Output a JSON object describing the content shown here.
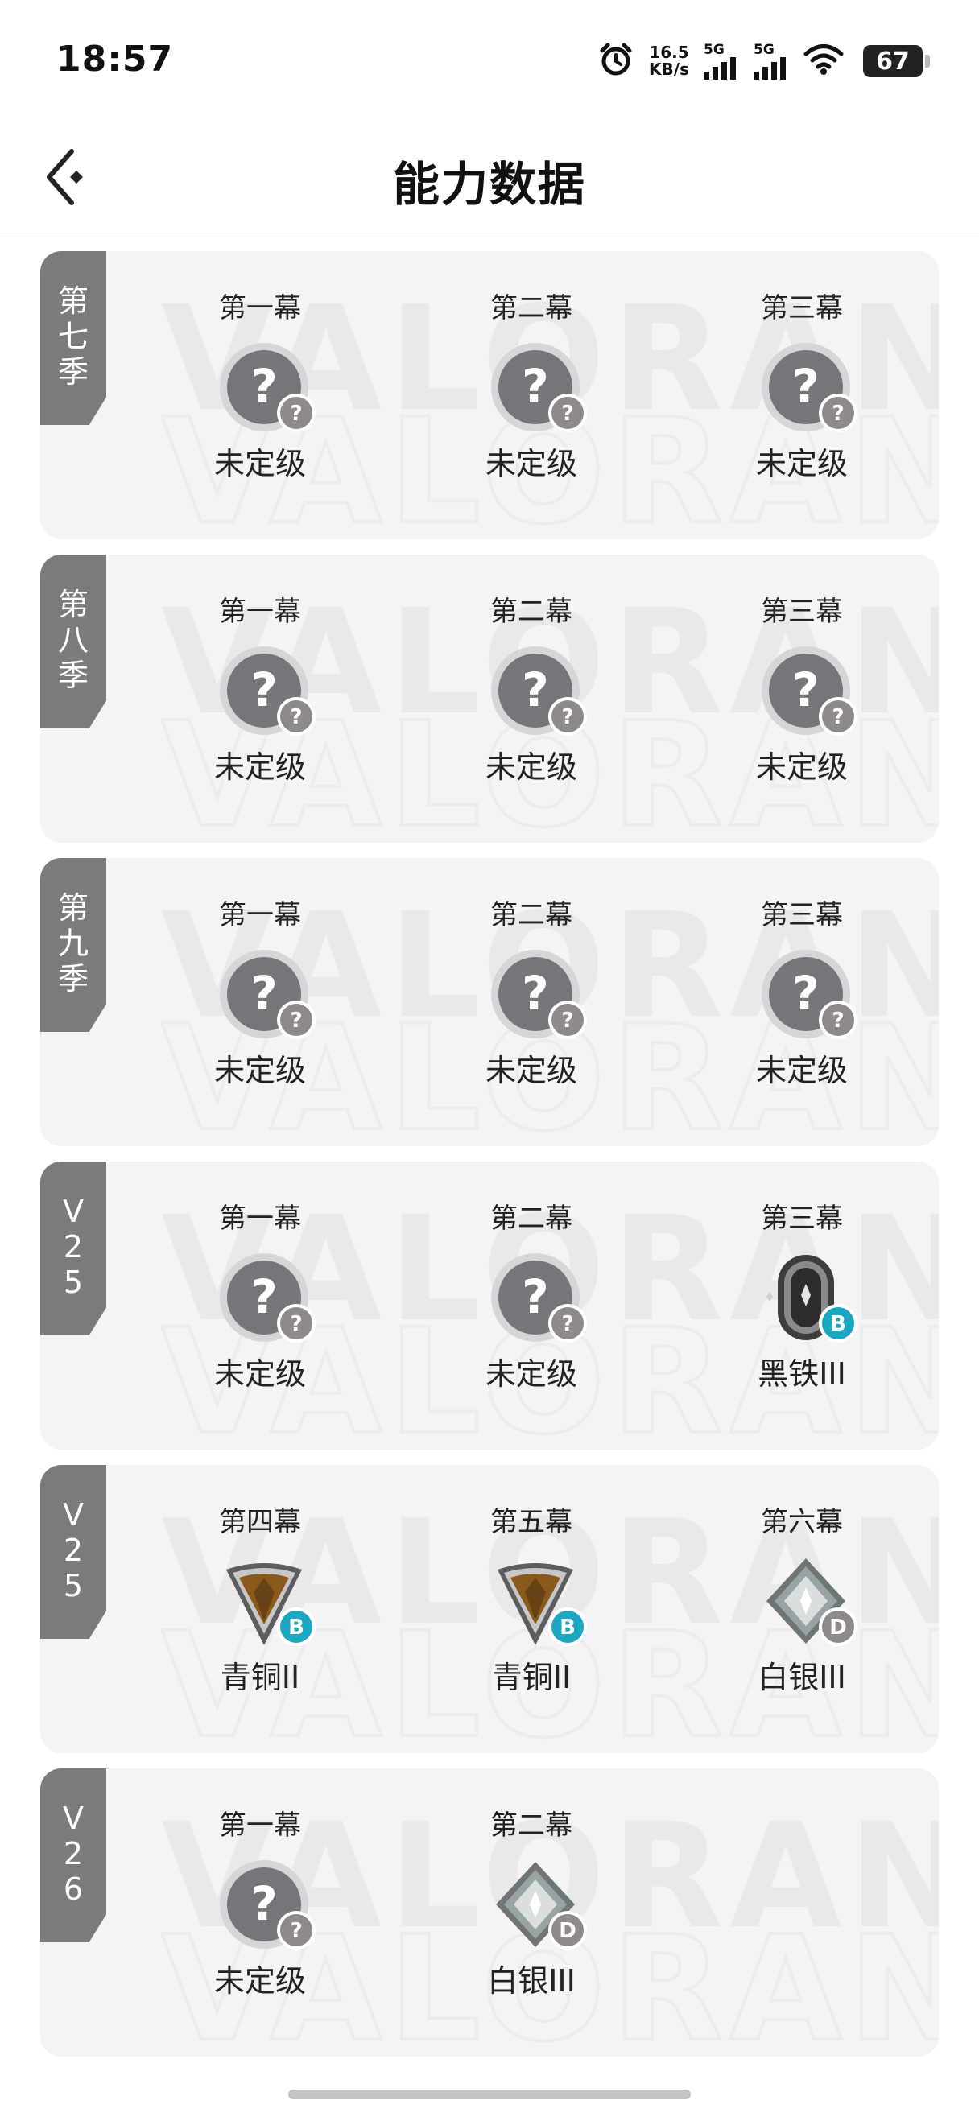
{
  "status_bar": {
    "time": "18:57",
    "net_speed_value": "16.5",
    "net_speed_unit": "KB/s",
    "sig1_label": "5G",
    "sig2_label": "5G",
    "battery": "67",
    "icons": [
      "alarm-icon",
      "signal-icon",
      "signal-icon",
      "wifi-icon",
      "battery-icon"
    ]
  },
  "header": {
    "title": "能力数据",
    "back_icon": "back-arrow-icon"
  },
  "colors": {
    "tab_bg": "#7b7b7d",
    "card_bg": "#f4f4f6",
    "unranked_grey": "#74767a",
    "bronze": "#8a5a1c",
    "silver": "#9aa3a3",
    "badge_teal": "#1aa7c2",
    "badge_grey": "#8e8a8b"
  },
  "watermark": "VALORANT",
  "seasons": [
    {
      "label": [
        "第",
        "七",
        "季"
      ],
      "acts": [
        {
          "name": "第一幕",
          "rank": "未定级",
          "icon": "unranked",
          "badge": "?"
        },
        {
          "name": "第二幕",
          "rank": "未定级",
          "icon": "unranked",
          "badge": "?"
        },
        {
          "name": "第三幕",
          "rank": "未定级",
          "icon": "unranked",
          "badge": "?"
        }
      ]
    },
    {
      "label": [
        "第",
        "八",
        "季"
      ],
      "acts": [
        {
          "name": "第一幕",
          "rank": "未定级",
          "icon": "unranked",
          "badge": "?"
        },
        {
          "name": "第二幕",
          "rank": "未定级",
          "icon": "unranked",
          "badge": "?"
        },
        {
          "name": "第三幕",
          "rank": "未定级",
          "icon": "unranked",
          "badge": "?"
        }
      ]
    },
    {
      "label": [
        "第",
        "九",
        "季"
      ],
      "acts": [
        {
          "name": "第一幕",
          "rank": "未定级",
          "icon": "unranked",
          "badge": "?"
        },
        {
          "name": "第二幕",
          "rank": "未定级",
          "icon": "unranked",
          "badge": "?"
        },
        {
          "name": "第三幕",
          "rank": "未定级",
          "icon": "unranked",
          "badge": "?"
        }
      ]
    },
    {
      "label": [
        "V",
        "2",
        "5"
      ],
      "acts": [
        {
          "name": "第一幕",
          "rank": "未定级",
          "icon": "unranked",
          "badge": "?"
        },
        {
          "name": "第二幕",
          "rank": "未定级",
          "icon": "unranked",
          "badge": "?"
        },
        {
          "name": "第三幕",
          "rank": "黑铁III",
          "icon": "iron",
          "badge": "B"
        }
      ]
    },
    {
      "label": [
        "V",
        "2",
        "5"
      ],
      "acts": [
        {
          "name": "第四幕",
          "rank": "青铜II",
          "icon": "bronze",
          "badge": "B"
        },
        {
          "name": "第五幕",
          "rank": "青铜II",
          "icon": "bronze",
          "badge": "B"
        },
        {
          "name": "第六幕",
          "rank": "白银III",
          "icon": "silver",
          "badge": "D"
        }
      ]
    },
    {
      "label": [
        "V",
        "2",
        "6"
      ],
      "acts": [
        {
          "name": "第一幕",
          "rank": "未定级",
          "icon": "unranked",
          "badge": "?"
        },
        {
          "name": "第二幕",
          "rank": "白银III",
          "icon": "silver",
          "badge": "D"
        }
      ]
    }
  ]
}
